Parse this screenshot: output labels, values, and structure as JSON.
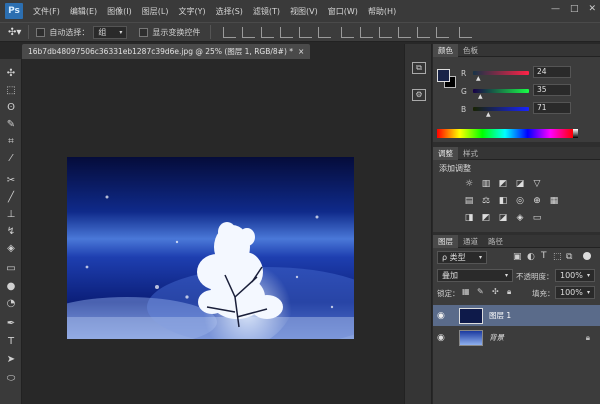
{
  "app": {
    "logo": "Ps"
  },
  "menu": [
    "文件(F)",
    "编辑(E)",
    "图像(I)",
    "图层(L)",
    "文字(Y)",
    "选择(S)",
    "滤镜(T)",
    "视图(V)",
    "窗口(W)",
    "帮助(H)"
  ],
  "window_controls": {
    "minimize": "—",
    "maximize": "□",
    "close": "✕"
  },
  "options": {
    "auto_select_label": "自动选择：",
    "auto_select_value": "组",
    "show_transform_label": "显示变换控件"
  },
  "document": {
    "tab_title": "16b7db48097506c36331eb1287c39d6e.jpg @ 25% (图层 1, RGB/8#) *",
    "close": "×"
  },
  "color_panel": {
    "tabs": [
      "颜色",
      "色板"
    ],
    "channels": [
      {
        "label": "R",
        "value": "24",
        "level": 0.094
      },
      {
        "label": "G",
        "value": "35",
        "level": 0.137
      },
      {
        "label": "B",
        "value": "71",
        "level": 0.278
      }
    ],
    "foreground": "#182347",
    "background": "#000000"
  },
  "adjust_panel": {
    "tabs": [
      "调整",
      "样式"
    ],
    "heading": "添加调整"
  },
  "layers_panel": {
    "tabs": [
      "图层",
      "通道",
      "路径"
    ],
    "filter_label": "ρ 类型",
    "blend_mode": "叠加",
    "opacity_label": "不透明度：",
    "opacity_value": "100%",
    "lock_label": "锁定：",
    "fill_label": "填充：",
    "fill_value": "100%",
    "layers": [
      {
        "name": "图层 1",
        "selected": true
      },
      {
        "name": "背景",
        "selected": false,
        "locked": true
      }
    ]
  },
  "icons": {
    "eye": "eye-icon",
    "lock": "lock-icon",
    "move": "move-tool-icon"
  }
}
